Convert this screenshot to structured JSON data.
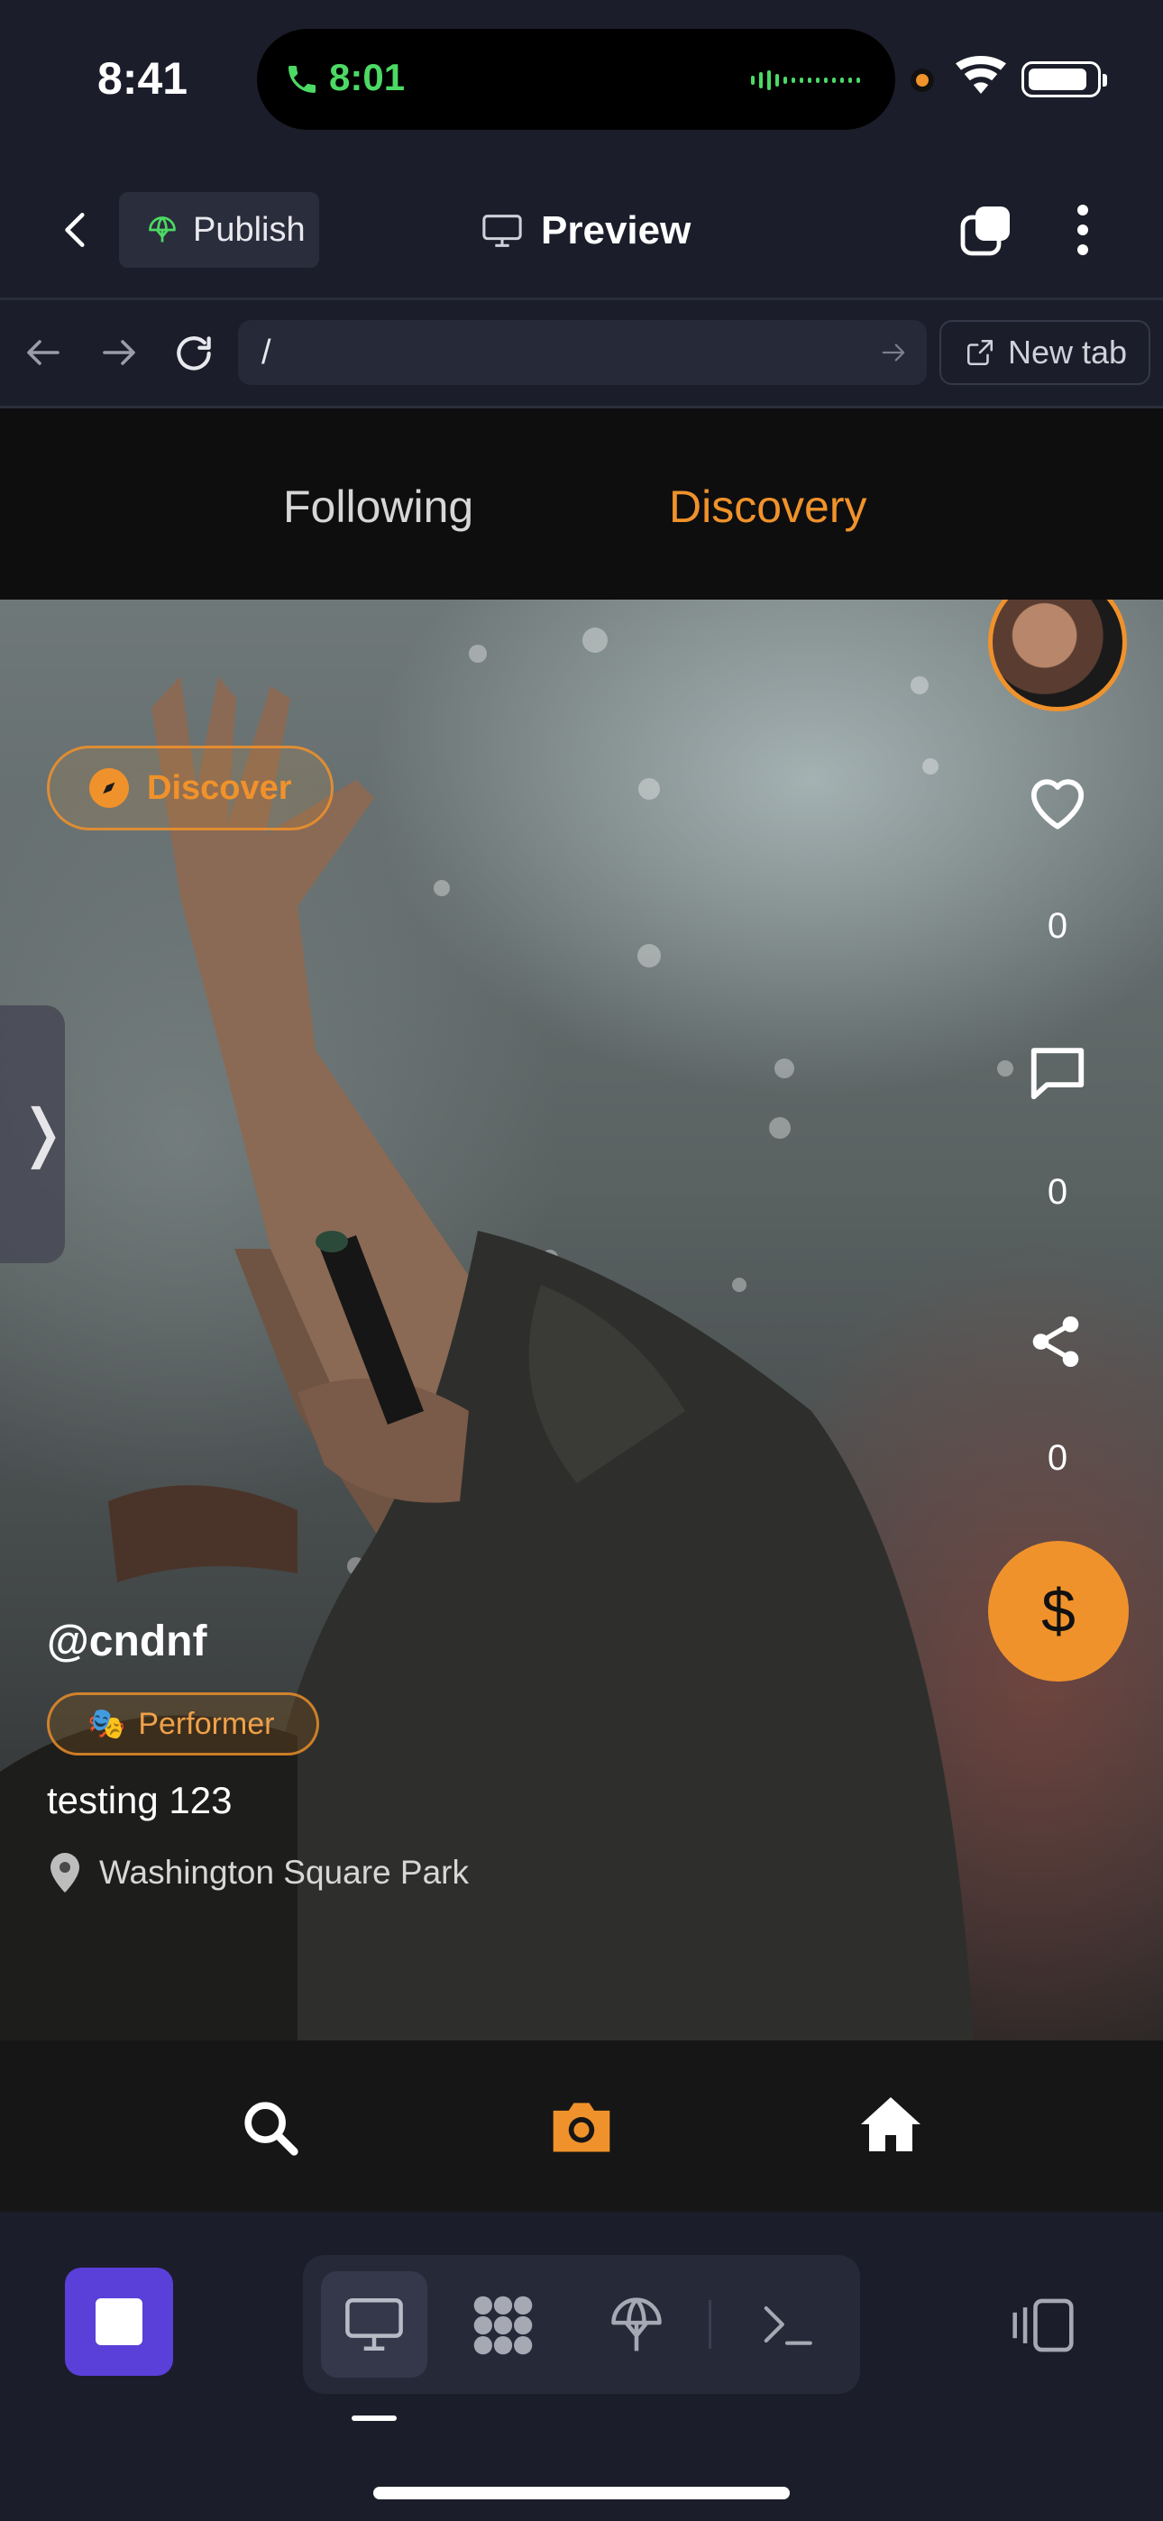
{
  "status_bar": {
    "time": "8:41",
    "call_time": "8:01"
  },
  "header": {
    "publish_label": "Publish",
    "preview_label": "Preview"
  },
  "browser": {
    "url": "/",
    "new_tab_label": "New tab"
  },
  "feed": {
    "tabs": [
      {
        "label": "Following",
        "active": false
      },
      {
        "label": "Discovery",
        "active": true
      }
    ],
    "discover_chip": "Discover",
    "side_handle": "❭",
    "actions": {
      "likes": "0",
      "comments": "0",
      "shares": "0",
      "tip_symbol": "$"
    },
    "post": {
      "username": "@cndnf",
      "role_emoji": "🎭",
      "role": "Performer",
      "caption": "testing 123",
      "location": "Washington Square Park"
    }
  },
  "bottom_nav": [
    "search-icon",
    "camera-icon",
    "home-icon"
  ],
  "colors": {
    "accent": "#f0922b",
    "dock_bg": "#1b1d2a",
    "stop_button": "#5a3fd8",
    "call_green": "#4cd964"
  }
}
